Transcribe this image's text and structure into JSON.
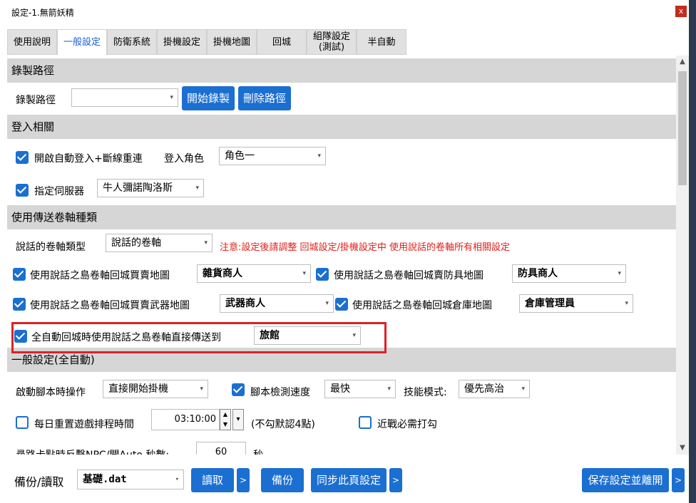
{
  "window": {
    "title": "設定-1.無箭妖精",
    "close_label": "x"
  },
  "tabs": [
    {
      "label": "使用說明"
    },
    {
      "label": "一般設定"
    },
    {
      "label": "防衛系統"
    },
    {
      "label": "掛機設定"
    },
    {
      "label": "掛機地圖"
    },
    {
      "label": "回城"
    },
    {
      "label": "組隊設定\n(測試)"
    },
    {
      "label": "半自動"
    }
  ],
  "record": {
    "section": "錄製路徑",
    "label": "錄製路徑",
    "path_value": "",
    "start_btn": "開始錄製",
    "delete_btn": "刪除路徑"
  },
  "login": {
    "section": "登入相關",
    "auto_login": "開啟自動登入+斷線重連",
    "role_label": "登入角色",
    "role_value": "角色一",
    "server_label": "指定伺服器",
    "server_value": "牛人彌諾陶洛斯"
  },
  "scroll": {
    "section": "使用傳送卷軸種類",
    "type_label": "說話的卷軸類型",
    "type_value": "說話的卷軸",
    "notice": "注意:設定後請調整 回城設定/掛機設定中 使用說話的卷軸所有相關設定",
    "opt1_label": "使用說話之島卷軸回城買賣地圖",
    "opt1_value": "雜貨商人",
    "opt2_label": "使用說話之島卷軸回城賣防具地圖",
    "opt2_value": "防具商人",
    "opt3_label": "使用說話之島卷軸回城買賣武器地圖",
    "opt3_value": "武器商人",
    "opt4_label": "使用說話之島卷軸回城倉庫地圖",
    "opt4_value": "倉庫管理員",
    "opt5_label": "全自動回城時使用說話之島卷軸直接傳送到",
    "opt5_value": "旅館"
  },
  "general": {
    "section": "一般設定(全自動)",
    "start_label": "啟動腳本時操作",
    "start_value": "直接開始掛機",
    "detect_label": "腳本檢測速度",
    "detect_value": "最快",
    "skill_label": "技能模式:",
    "skill_value": "優先高治",
    "reset_label": "每日重置遊戲排程時間",
    "reset_time": "03:10:00",
    "reset_hint": "(不勾默認4點)",
    "melee_label": "近戰必需打勾",
    "stuck_label": "尋路卡點時反擊NPC/開Auto 秒數:",
    "stuck_value": "60",
    "stuck_unit": "秒"
  },
  "footer": {
    "backup_label": "備份/讀取",
    "file_value": "基礎.dat",
    "read_btn": "讀取",
    "more": ">",
    "backup_btn": "備份",
    "sync_btn": "同步此頁設定",
    "save_btn": "保存設定並離開"
  }
}
